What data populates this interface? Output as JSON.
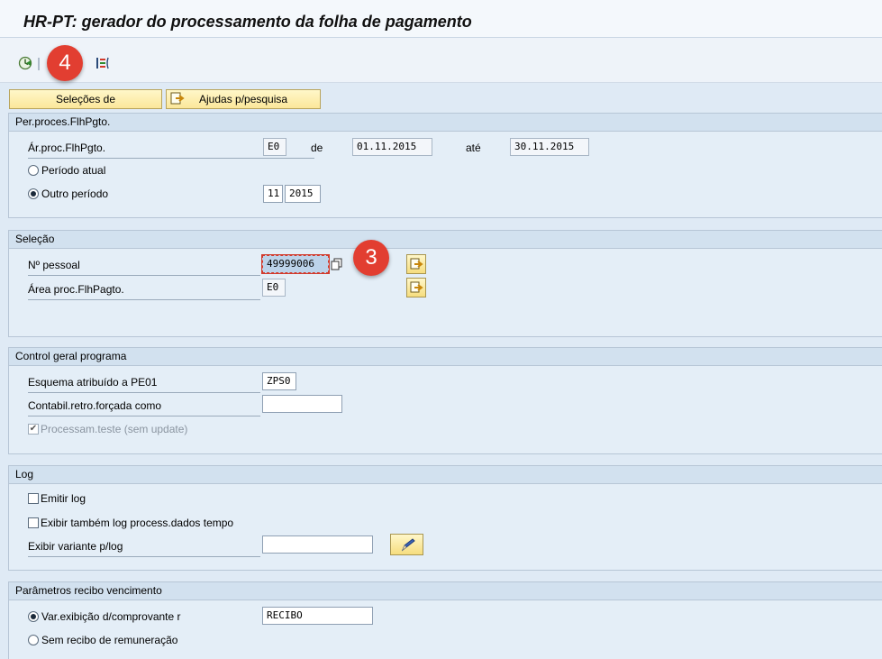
{
  "window": {
    "title": "HR-PT: gerador do processamento da folha de pagamento"
  },
  "toolbar": {
    "execute_icon": "execute-clock-icon",
    "variant_icon": "selection-variant-icon"
  },
  "annotations": {
    "step_toolbar": "4",
    "step_field": "3"
  },
  "tabs": {
    "selections_label": "Seleções de",
    "help_label": "Ajudas p/pesquisa"
  },
  "period_group": {
    "title": "Per.proces.FlhPgto.",
    "area_label": "Ár.proc.FlhPgto.",
    "area_value": "E0",
    "from_label": "de",
    "from_value": "01.11.2015",
    "to_label": "até",
    "to_value": "30.11.2015",
    "current_period_label": "Período atual",
    "other_period_label": "Outro período",
    "period_month": "11",
    "period_year": "2015",
    "selected_option": "other_period"
  },
  "selection_group": {
    "title": "Seleção",
    "personnel_label": "Nº pessoal",
    "personnel_value": "49999006",
    "payroll_area_label": "Área proc.FlhPagto.",
    "payroll_area_value": "E0"
  },
  "program_group": {
    "title": "Control geral programa",
    "schema_label": "Esquema atribuído a PE01",
    "schema_value": "ZPS0",
    "retro_label": "Contabil.retro.forçada como",
    "retro_value": "",
    "test_run_label": "Processam.teste (sem update)",
    "test_run_checked": true
  },
  "log_group": {
    "title": "Log",
    "emit_log_label": "Emitir log",
    "time_log_label": "Exibir também log process.dados tempo",
    "variant_label": "Exibir variante p/log",
    "variant_value": ""
  },
  "payslip_group": {
    "title": "Parâmetros recibo vencimento",
    "variant_label": "Var.exibição d/comprovante r",
    "variant_value": "RECIBO",
    "no_payslip_label": "Sem recibo de remuneração",
    "selected_option": "variant"
  },
  "colors": {
    "background": "#dfeaf5",
    "group_header": "#d2e1ef",
    "button_yellow": "#fbe79a",
    "badge_red": "#e23e31"
  }
}
